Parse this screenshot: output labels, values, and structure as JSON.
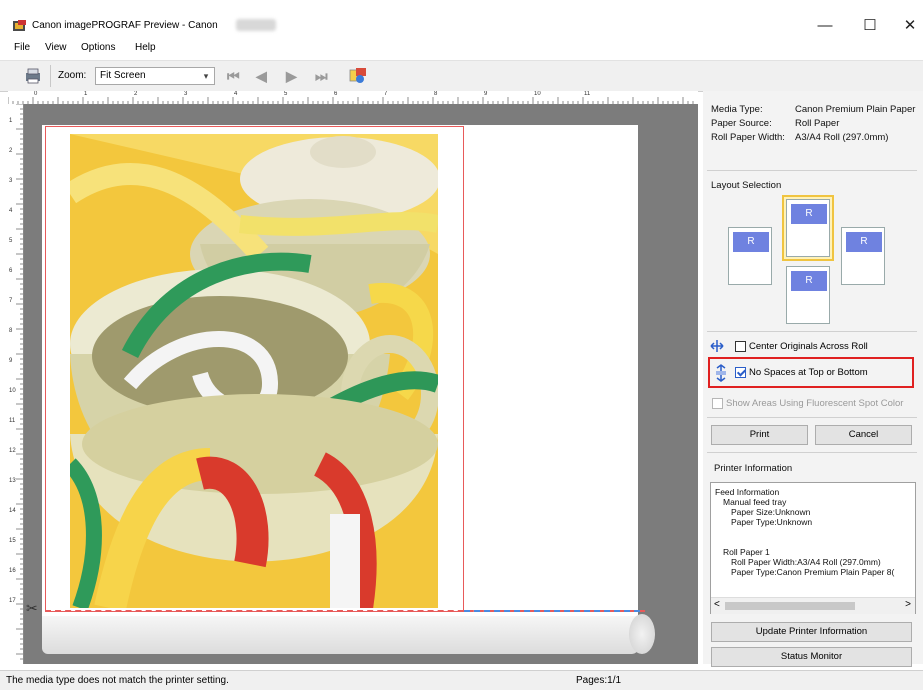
{
  "window": {
    "title": "Canon imagePROGRAF Preview - Canon",
    "minimize_glyph": "—",
    "maximize_glyph": "☐",
    "close_glyph": "✕"
  },
  "menu": [
    "File",
    "View",
    "Options",
    "Help"
  ],
  "toolbar": {
    "zoom_label": "Zoom:",
    "zoom_value": "Fit Screen",
    "nav_first": "⏮",
    "nav_prev": "◀",
    "nav_next": "▶",
    "nav_last": "⏭"
  },
  "ruler": {
    "top_marks": [
      "0",
      "1",
      "2",
      "3",
      "4",
      "5",
      "6",
      "7",
      "8",
      "9",
      "10",
      "11"
    ],
    "left_marks": [
      "1",
      "2",
      "3",
      "4",
      "5",
      "6",
      "7",
      "8",
      "9",
      "10",
      "11",
      "12",
      "13",
      "14",
      "15",
      "16",
      "17"
    ]
  },
  "info": {
    "media_type_label": "Media Type:",
    "media_type_value": "Canon Premium Plain Paper",
    "paper_source_label": "Paper Source:",
    "paper_source_value": "Roll Paper",
    "roll_width_label": "Roll Paper Width:",
    "roll_width_value": "A3/A4 Roll (297.0mm)"
  },
  "layout": {
    "heading": "Layout Selection",
    "card_glyph": "R"
  },
  "options": {
    "center_originals": {
      "label": "Center Originals Across Roll",
      "checked": false
    },
    "no_spaces": {
      "label": "No Spaces at Top or Bottom",
      "checked": true
    },
    "fluorescent": {
      "label": "Show Areas Using Fluorescent Spot Color",
      "checked": false,
      "enabled": false
    }
  },
  "buttons": {
    "print": "Print",
    "cancel": "Cancel",
    "update_printer_info": "Update Printer Information",
    "status_monitor": "Status Monitor"
  },
  "printer_info": {
    "heading": "Printer Information",
    "lines": [
      "Feed Information",
      "Manual feed tray",
      "Paper Size:Unknown",
      "Paper Type:Unknown",
      "",
      "Roll Paper 1",
      "Roll Paper Width:A3/A4 Roll (297.0mm)",
      "Paper Type:Canon Premium Plain Paper 8("
    ],
    "scroll_left": "<",
    "scroll_right": ">"
  },
  "status": {
    "message": "The media type does not match the printer setting.",
    "pages": "Pages:1/1"
  },
  "colors": {
    "canvas_bg": "#7c7c7c",
    "highlight": "#e02020",
    "layout_selected": "#f0c440",
    "layout_card_accent": "#6f82e0"
  }
}
